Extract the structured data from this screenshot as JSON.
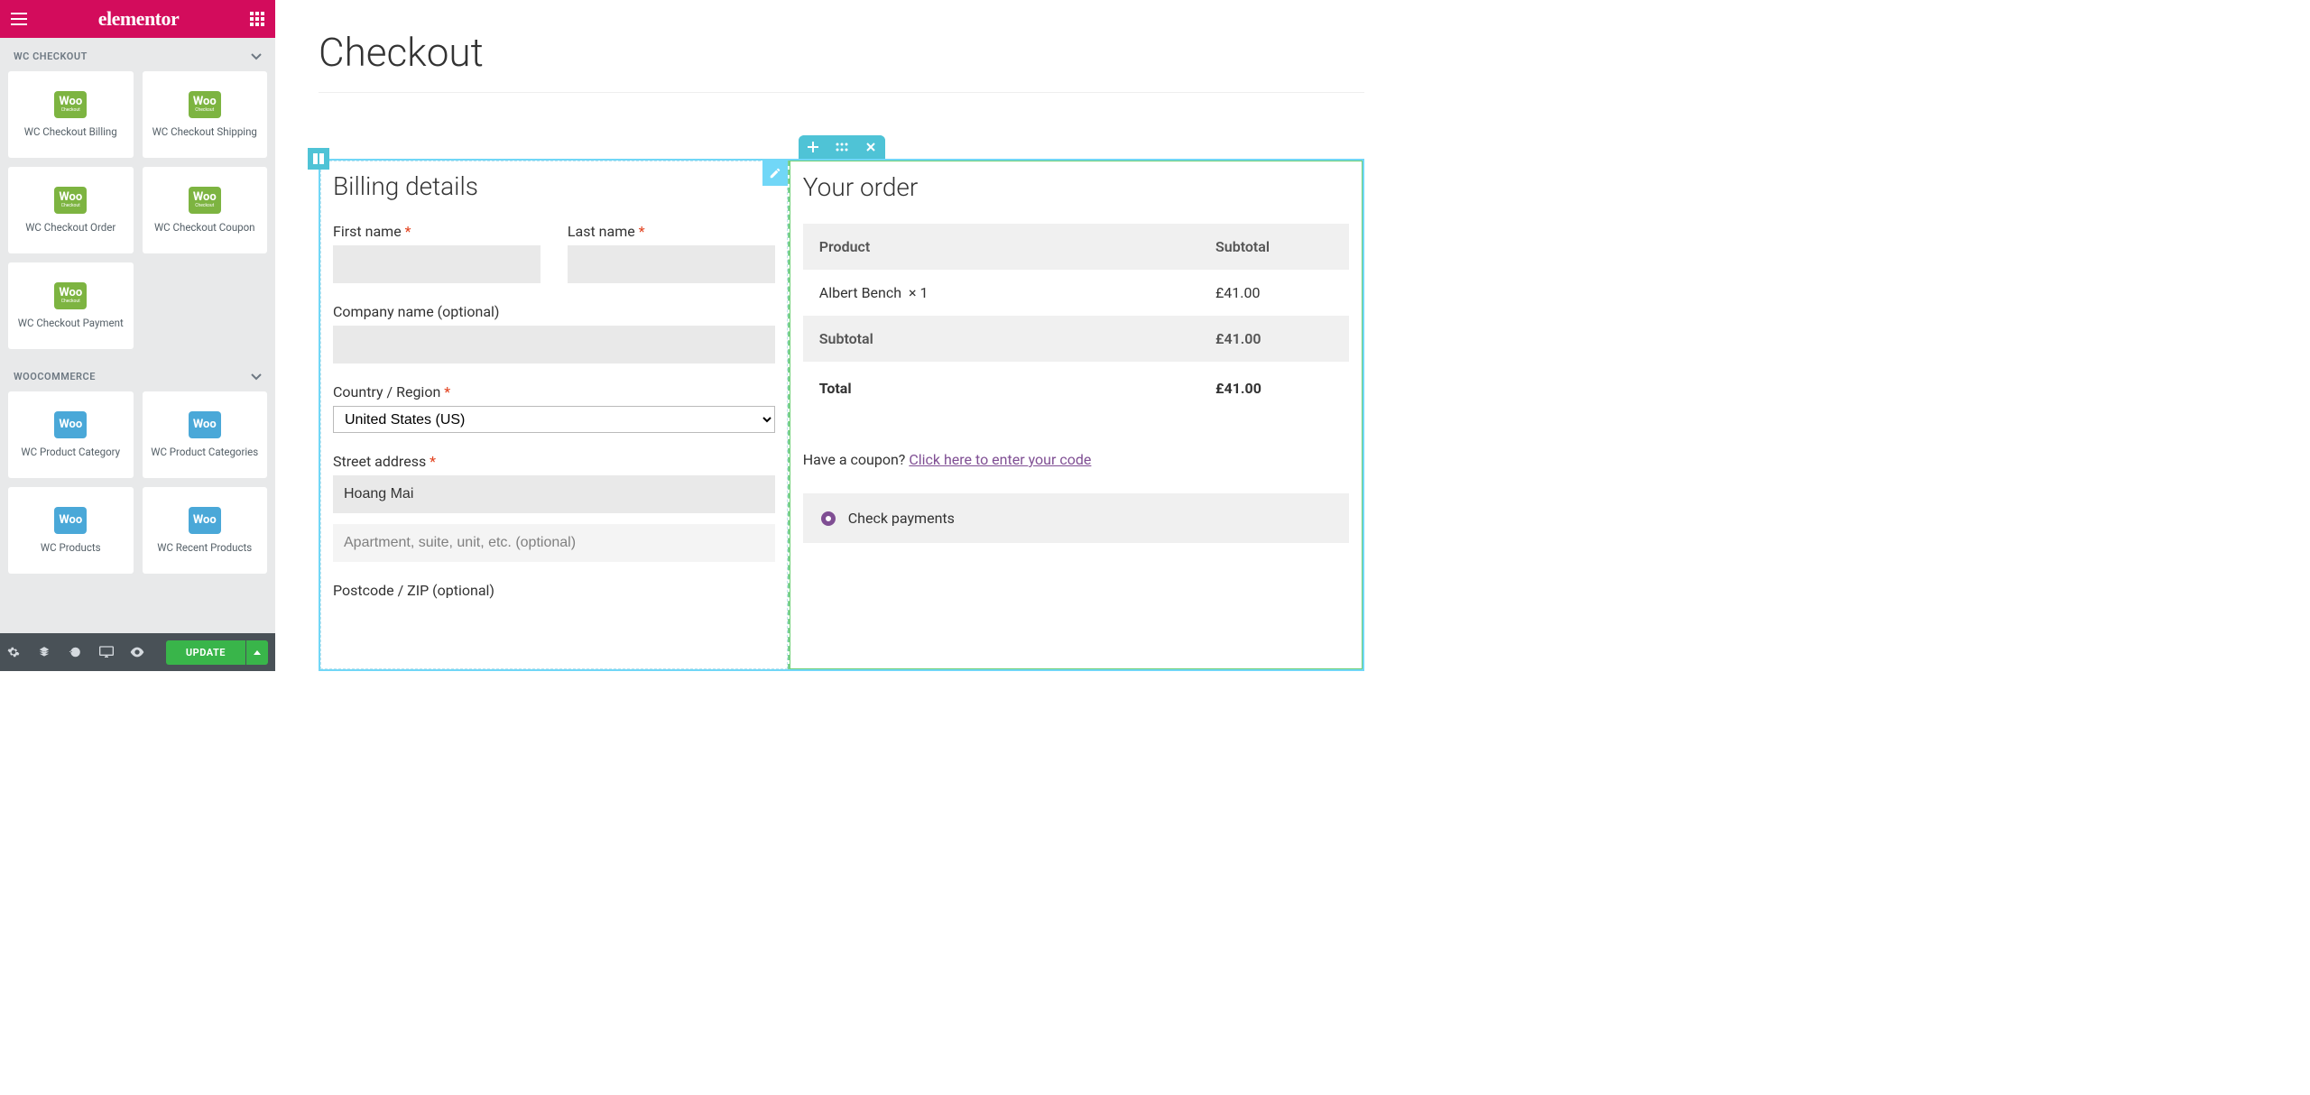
{
  "header": {
    "brand": "elementor"
  },
  "sidebar": {
    "sections": [
      {
        "title": "WC CHECKOUT",
        "widgets": [
          {
            "label": "WC Checkout Billing",
            "icon_sub": "Checkout",
            "color": "green"
          },
          {
            "label": "WC Checkout Shipping",
            "icon_sub": "Checkout",
            "color": "green"
          },
          {
            "label": "WC Checkout Order",
            "icon_sub": "Checkout",
            "color": "green"
          },
          {
            "label": "WC Checkout Coupon",
            "icon_sub": "Checkout",
            "color": "green"
          },
          {
            "label": "WC Checkout Payment",
            "icon_sub": "Checkout",
            "color": "green"
          }
        ]
      },
      {
        "title": "WOOCOMMERCE",
        "widgets": [
          {
            "label": "WC Product Category",
            "icon_sub": "",
            "color": "blue"
          },
          {
            "label": "WC Product Categories",
            "icon_sub": "",
            "color": "blue"
          },
          {
            "label": "WC Products",
            "icon_sub": "",
            "color": "blue"
          },
          {
            "label": "WC Recent Products",
            "icon_sub": "",
            "color": "blue"
          }
        ]
      }
    ]
  },
  "footer": {
    "update_label": "UPDATE"
  },
  "page": {
    "title": "Checkout",
    "billing": {
      "heading": "Billing details",
      "first_name_label": "First name",
      "last_name_label": "Last name",
      "company_label": "Company name (optional)",
      "country_label": "Country / Region",
      "country_value": "United States (US)",
      "street_label": "Street address",
      "street_value": "Hoang Mai",
      "street2_placeholder": "Apartment, suite, unit, etc. (optional)",
      "postcode_label": "Postcode / ZIP (optional)"
    },
    "order": {
      "heading": "Your order",
      "head_product": "Product",
      "head_subtotal": "Subtotal",
      "item_name": "Albert Bench",
      "item_qty": "× 1",
      "item_price": "£41.00",
      "subtotal_label": "Subtotal",
      "subtotal_value": "£41.00",
      "total_label": "Total",
      "total_value": "£41.00",
      "coupon_prompt": "Have a coupon? ",
      "coupon_link": "Click here to enter your code",
      "payment_option": "Check payments"
    }
  },
  "icons": {
    "woo": "Woo"
  }
}
